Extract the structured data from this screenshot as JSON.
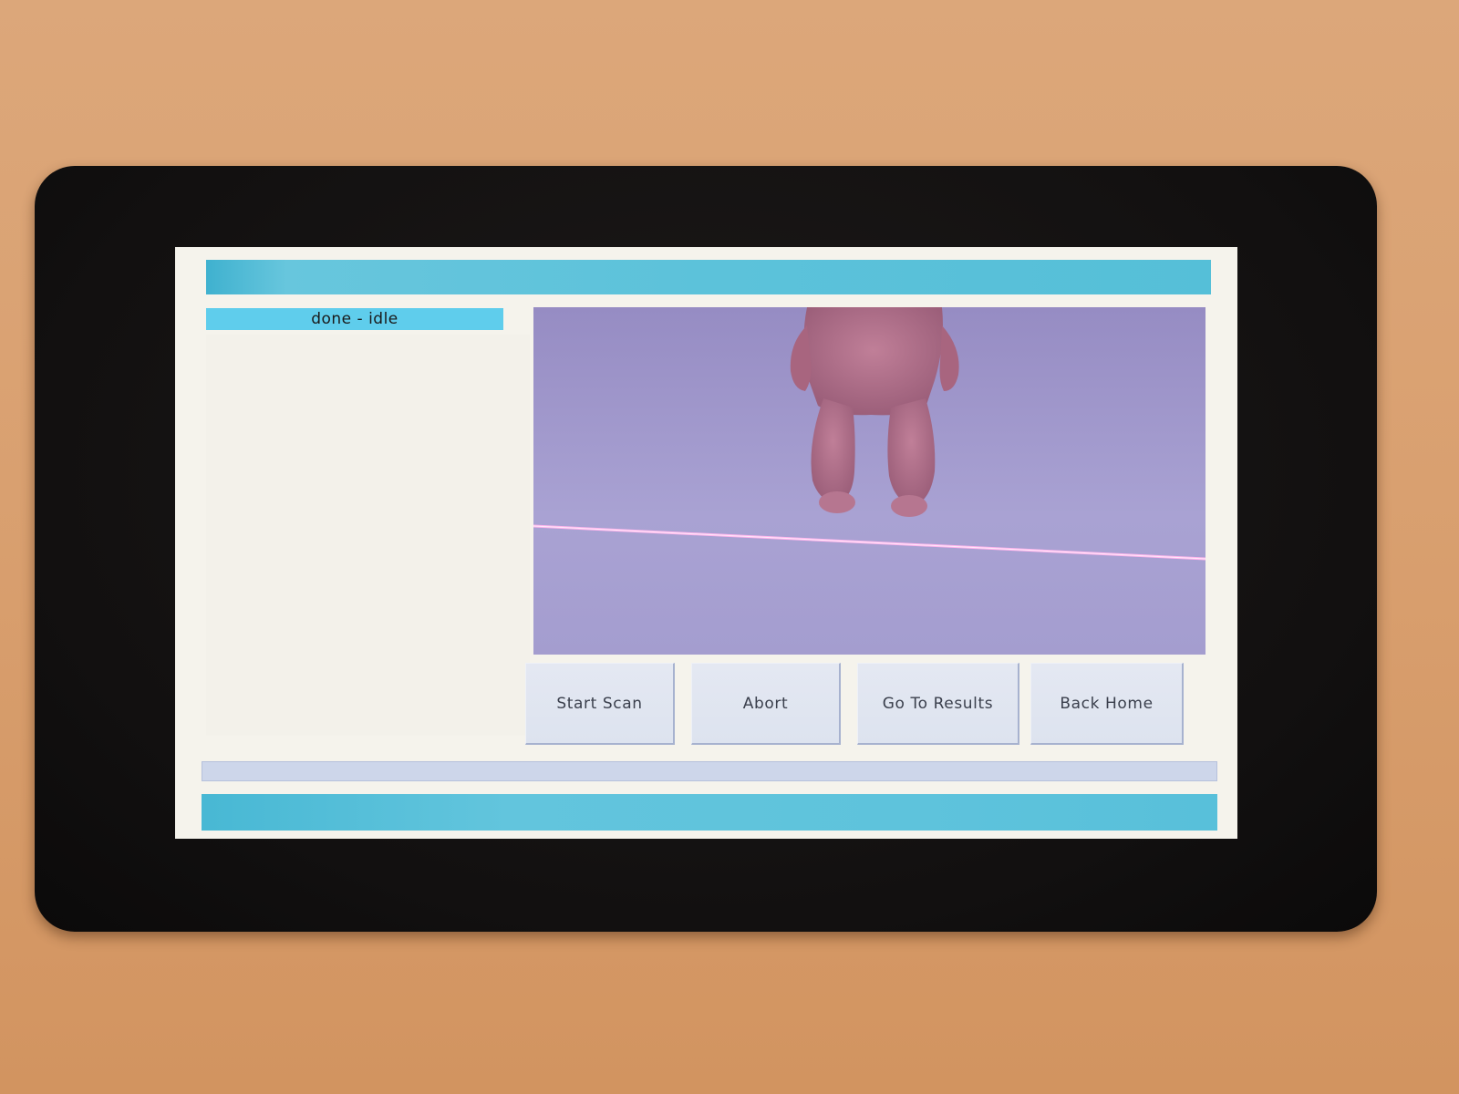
{
  "status": {
    "text": "done - idle"
  },
  "buttons": {
    "start_scan": "Start Scan",
    "abort": "Abort",
    "go_to_results": "Go To Results",
    "back_home": "Back Home"
  },
  "progress": {
    "value": 0
  },
  "colors": {
    "accent_bar": "#5cc2da",
    "status_label": "#5fcdec",
    "button_face": "#e0e5f0",
    "screen_background": "#f5f3ec",
    "camera_background": "#a59dd0",
    "laser_line": "#ff9ee6"
  }
}
